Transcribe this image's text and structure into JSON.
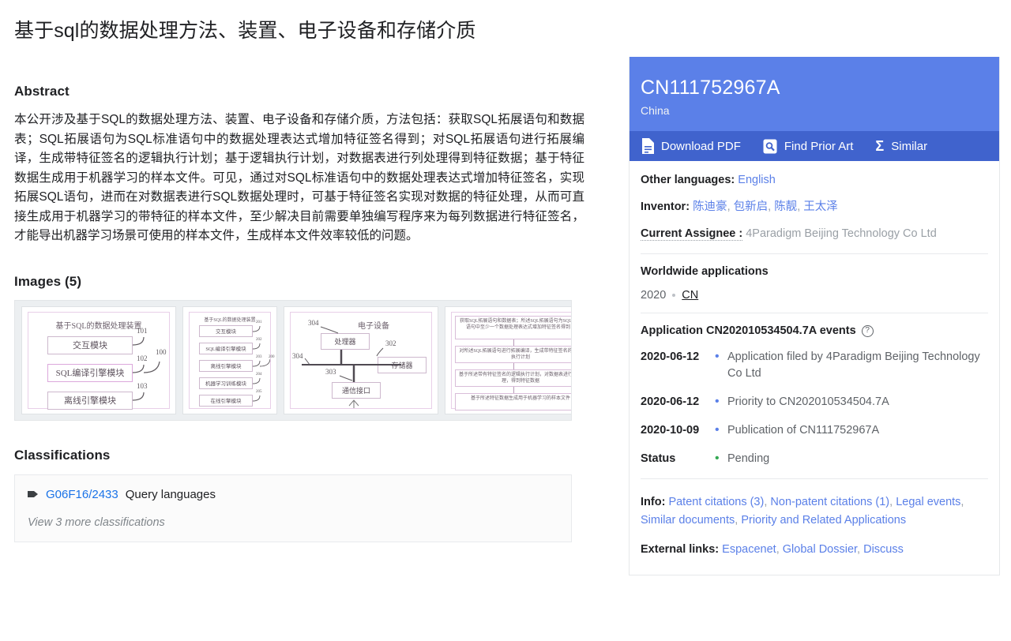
{
  "document": {
    "title": "基于sql的数据处理方法、装置、电子设备和存储介质",
    "abstract_heading": "Abstract",
    "abstract_text": "本公开涉及基于SQL的数据处理方法、装置、电子设备和存储介质，方法包括：获取SQL拓展语句和数据表；SQL拓展语句为SQL标准语句中的数据处理表达式增加特征签名得到；对SQL拓展语句进行拓展编译，生成带特征签名的逻辑执行计划；基于逻辑执行计划，对数据表进行列处理得到特征数据；基于特征数据生成用于机器学习的样本文件。可见，通过对SQL标准语句中的数据处理表达式增加特征签名，实现拓展SQL语句，进而在对数据表进行SQL数据处理时，可基于特征签名实现对数据的特征处理，从而可直接生成用于机器学习的带特征的样本文件，至少解决目前需要单独编写程序来为每列数据进行特征签名，才能导出机器学习场景可使用的样本文件，生成样本文件效率较低的问题。",
    "images_heading": "Images (5)",
    "classifications_heading": "Classifications"
  },
  "figures": [
    {
      "title": "基于SQL的数据处理装置",
      "boxes": [
        "交互模块",
        "SQL编译引擎模块",
        "离线引擎模块"
      ],
      "refs": [
        "101",
        "102",
        "103",
        "100"
      ]
    },
    {
      "title": "基于SQL的数据处理装置",
      "boxes": [
        "交互模块",
        "SQL编译引擎模块",
        "离线引擎模块",
        "机器学习训练模块",
        "在线引擎模块"
      ],
      "refs": [
        "201",
        "202",
        "203",
        "204",
        "205",
        "200"
      ]
    },
    {
      "title": "电子设备",
      "boxes": [
        "处理器",
        "存储器",
        "通信接口"
      ],
      "refs": [
        "304",
        "302",
        "303",
        "304"
      ]
    },
    {
      "steps": [
        "获取SQL拓展语句和数据表；所述SQL拓展语句为SQL标准语句中至少一个数据处理表达式增加特征签名得到；",
        "对所述SQL拓展语句进行拓展编译，生成带特征签名的逻辑执行计划",
        "基于所述带有特征签名的逻辑执行计划，对数据表进行列处理，得到特征数据",
        "基于所述特征数据生成用于机器学习的样本文件"
      ]
    }
  ],
  "classifications": {
    "tag_icon": "tag-icon",
    "items": [
      {
        "code": "G06F16/2433",
        "description": "Query languages"
      }
    ],
    "more_label": "View 3 more classifications"
  },
  "sidebar": {
    "publication_number": "CN111752967A",
    "country": "China",
    "actions": [
      {
        "icon": "pdf-document-icon",
        "label": "Download PDF"
      },
      {
        "icon": "prior-art-search-icon",
        "label": "Find Prior Art"
      },
      {
        "icon": "sigma-icon",
        "label": "Similar",
        "glyph": "Σ"
      }
    ],
    "meta": {
      "other_languages_label": "Other languages:",
      "other_languages_value": "English",
      "inventor_label": "Inventor:",
      "inventors": [
        "陈迪豪",
        "包新启",
        "陈靓",
        "王太泽"
      ],
      "assignee_label": "Current Assignee :",
      "assignee_value": "4Paradigm Beijing Technology Co Ltd"
    },
    "worldwide": {
      "heading": "Worldwide applications",
      "year": "2020",
      "country_code": "CN"
    },
    "events": {
      "heading": "Application CN202010534504.7A events",
      "help_icon": "help-circle-icon",
      "rows": [
        {
          "date": "2020-06-12",
          "text": "Application filed by 4Paradigm Beijing Technology Co Ltd",
          "status_color": "#5b80e8"
        },
        {
          "date": "2020-06-12",
          "text": "Priority to CN202010534504.7A",
          "status_color": "#5b80e8"
        },
        {
          "date": "2020-10-09",
          "text": "Publication of CN111752967A",
          "status_color": "#5b80e8"
        },
        {
          "date": "Status",
          "text": "Pending",
          "status_color": "#34a853"
        }
      ]
    },
    "links": {
      "info_label": "Info:",
      "info_links": [
        "Patent citations (3)",
        "Non-patent citations (1)",
        "Legal events",
        "Similar documents",
        "Priority and Related Applications"
      ],
      "external_label": "External links:",
      "external_links": [
        "Espacenet",
        "Global Dossier",
        "Discuss"
      ]
    }
  },
  "colors": {
    "header_blue": "#5b80e8",
    "action_bar_blue": "#4063cd",
    "link_blue": "#5b80e8",
    "classification_link": "#1a73e8",
    "status_green": "#34a853",
    "muted_text": "#5f6368"
  }
}
